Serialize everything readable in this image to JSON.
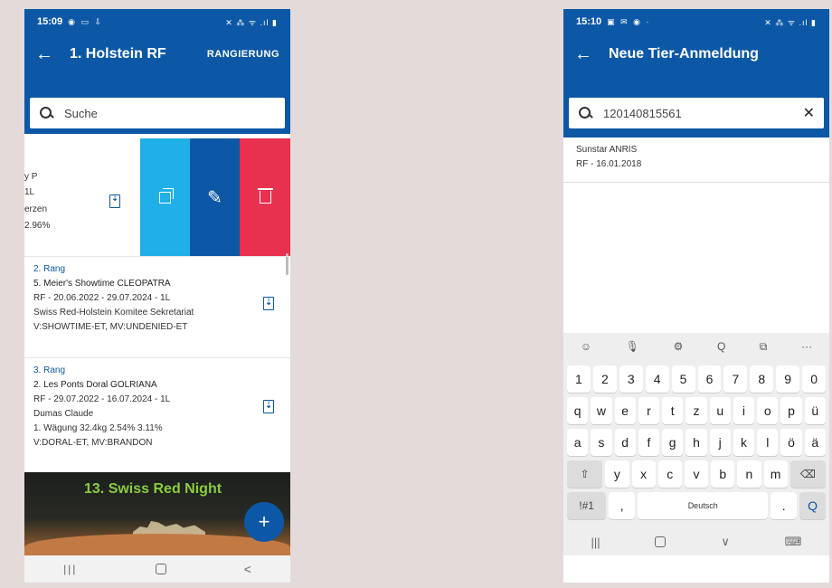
{
  "left": {
    "status": {
      "time": "15:09",
      "icons_left": "◉ ▭ ⇩",
      "icons_right": "✕ ⁂ ᯤ .ıl ▮"
    },
    "appbar": {
      "back": "←",
      "title": "1. Holstein RF",
      "action": "RANGIERUNG"
    },
    "search": {
      "placeholder": "Suche"
    },
    "swiped_row": {
      "line1": "y P",
      "line2": "1L",
      "line3": "erzen",
      "line4": "2.96%"
    },
    "entries": [
      {
        "rank": "2. Rang",
        "name": "5. Meier's Showtime CLEOPATRA",
        "line1": "RF - 20.06.2022 - 29.07.2024 - 1L",
        "line2": "Swiss Red-Holstein Komitee Sekretariat",
        "line3": "V:SHOWTIME-ET, MV:UNDENIED-ET"
      },
      {
        "rank": "3. Rang",
        "name": "2. Les Ponts Doral GOLRIANA",
        "line1": "RF - 29.07.2022 - 16.07.2024 - 1L",
        "line2": "Dumas Claude",
        "line3": "1. Wägung 32.4kg 2.54% 3.11%",
        "line4": "V:DORAL-ET, MV:BRANDON"
      }
    ],
    "banner_title": "13. Swiss Red Night",
    "fab": "+",
    "nav": {
      "recents": "|||",
      "back": "<"
    }
  },
  "right": {
    "status": {
      "time": "15:10",
      "icons_left": "▣ ✉ ◉ ·",
      "icons_right": "✕ ⁂ ᯤ .ıl ▮"
    },
    "appbar": {
      "back": "←",
      "title": "Neue Tier-Anmeldung"
    },
    "search": {
      "value": "120140815561",
      "clear": "✕"
    },
    "result": {
      "name": "Sunstar ANRIS",
      "detail": "RF - 16.01.2018"
    },
    "keyboard": {
      "toolbar": [
        "☺",
        "🎙",
        "⚙",
        "Q",
        "⧉",
        "···"
      ],
      "row1": [
        "1",
        "2",
        "3",
        "4",
        "5",
        "6",
        "7",
        "8",
        "9",
        "0"
      ],
      "row2": [
        "q",
        "w",
        "e",
        "r",
        "t",
        "z",
        "u",
        "i",
        "o",
        "p",
        "ü"
      ],
      "row3": [
        "a",
        "s",
        "d",
        "f",
        "g",
        "h",
        "j",
        "k",
        "l",
        "ö",
        "ä"
      ],
      "row4": [
        "⇧",
        "y",
        "x",
        "c",
        "v",
        "b",
        "n",
        "m",
        "⌫"
      ],
      "row5": [
        "!#1",
        ",",
        "Deutsch",
        ".",
        "Q"
      ],
      "nav": [
        "|||",
        "∨",
        "⌨"
      ]
    }
  }
}
